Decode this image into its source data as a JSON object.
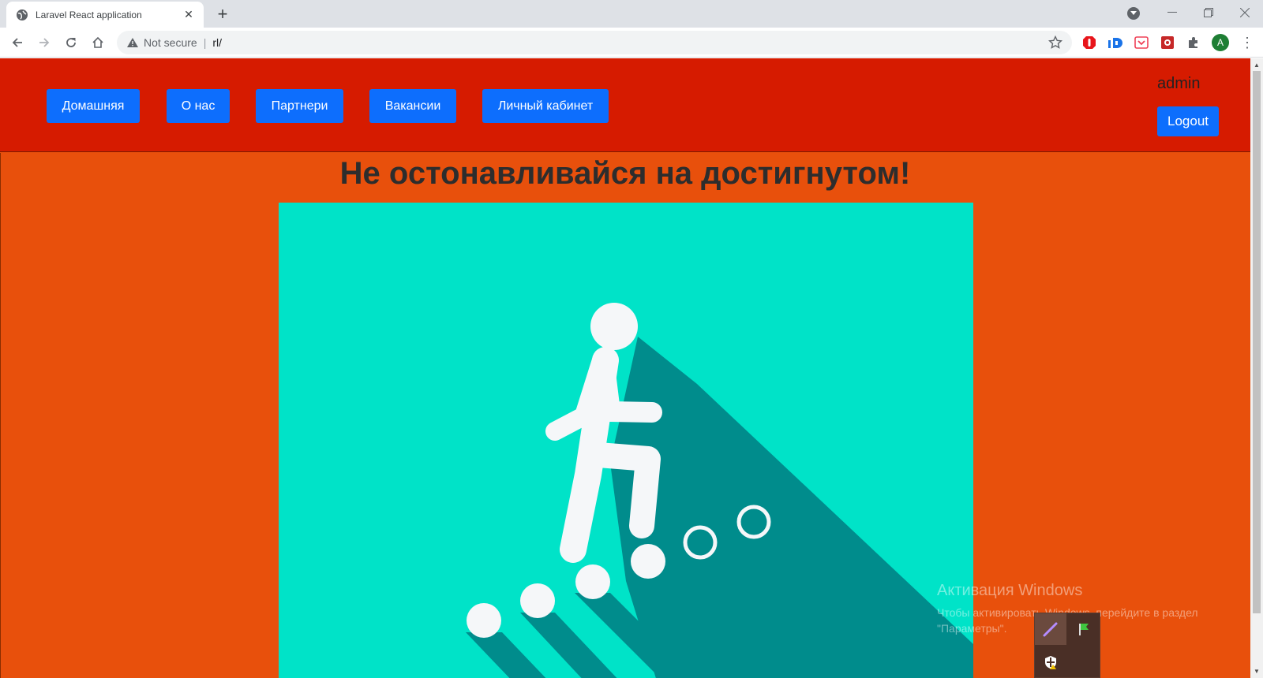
{
  "browser": {
    "tab_title": "Laravel React application",
    "not_secure_label": "Not secure",
    "url_separator": "|",
    "url": "rl/",
    "profile_initial": "A",
    "icons": {
      "back": "arrow-left-icon",
      "forward": "arrow-right-icon",
      "reload": "reload-icon",
      "home": "home-icon",
      "bookmark": "star-icon",
      "extensions": "puzzle-icon",
      "menu": "kebab-icon"
    }
  },
  "header": {
    "nav": [
      {
        "label": "Домашняя"
      },
      {
        "label": "О нас"
      },
      {
        "label": "Партнери"
      },
      {
        "label": "Вакансии"
      },
      {
        "label": "Личный кабинет"
      }
    ],
    "username": "admin",
    "logout_label": "Logout"
  },
  "main": {
    "headline": "Не остонавливайся на достигнутом!"
  },
  "os_overlay": {
    "activation_title": "Активация Windows",
    "activation_text": "Чтобы активировать Windows, перейдите в раздел \"Параметры\"."
  },
  "colors": {
    "header_bg": "#d61b00",
    "page_bg": "#e8500c",
    "button_bg": "#0d6efd",
    "hero_bg": "#00e3c8",
    "hero_shadow": "#008c8c"
  }
}
